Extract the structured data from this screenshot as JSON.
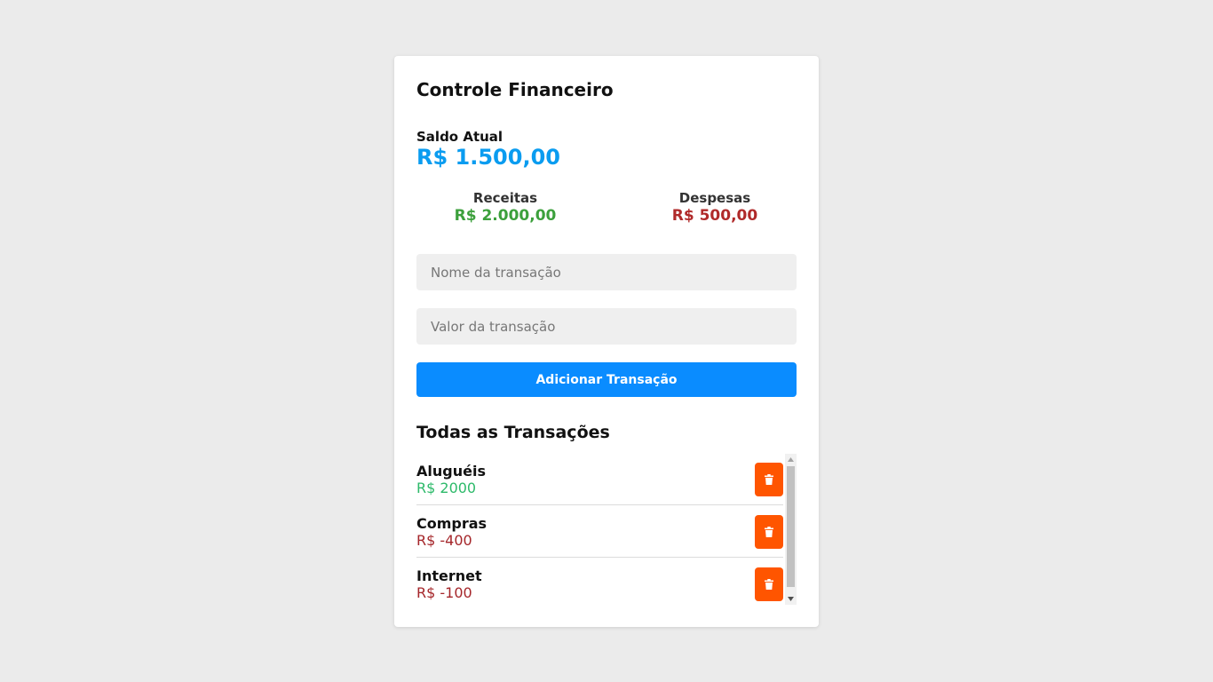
{
  "app": {
    "title": "Controle Financeiro"
  },
  "balance": {
    "label": "Saldo Atual",
    "value": "R$ 1.500,00"
  },
  "summary": {
    "income_label": "Receitas",
    "income_value": "R$ 2.000,00",
    "expense_label": "Despesas",
    "expense_value": "R$ 500,00"
  },
  "form": {
    "name_placeholder": "Nome da transação",
    "name_value": "",
    "value_placeholder": "Valor da transação",
    "value_value": "",
    "submit_label": "Adicionar Transação"
  },
  "transactions": {
    "title": "Todas as Transações",
    "items": [
      {
        "name": "Aluguéis",
        "amount": "R$ 2000"
      },
      {
        "name": "Compras",
        "amount": "R$ -400"
      },
      {
        "name": "Internet",
        "amount": "R$ -100"
      }
    ],
    "delete_icon": "trash-icon"
  },
  "colors": {
    "balance": "#0a9cf0",
    "income": "#3ca03c",
    "expense": "#b02a2a",
    "positive_amount": "#2dba6a",
    "negative_amount": "#a5262a",
    "primary_button": "#0a8cff",
    "delete_button": "#ff5500"
  }
}
